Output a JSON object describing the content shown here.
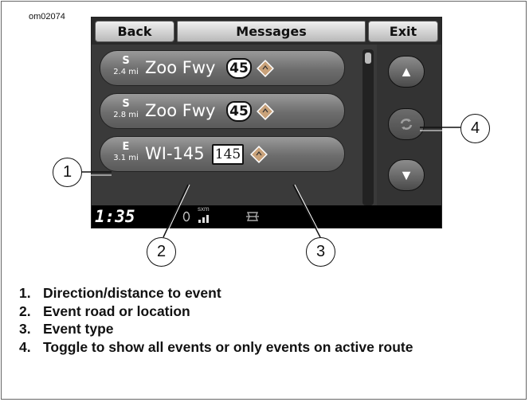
{
  "figure_id": "om02074",
  "screen": {
    "back_label": "Back",
    "title": "Messages",
    "exit_label": "Exit",
    "messages": [
      {
        "direction": "S",
        "distance": "2.4 mi",
        "road": "Zoo Fwy",
        "route_number": "45",
        "route_type": "us-interstate-shield"
      },
      {
        "direction": "S",
        "distance": "2.8 mi",
        "road": "Zoo Fwy",
        "route_number": "45",
        "route_type": "us-interstate-shield"
      },
      {
        "direction": "E",
        "distance": "3.1 mi",
        "road": "WI-145",
        "route_number": "145",
        "route_type": "state-route-shield"
      }
    ],
    "event_icon": "construction-diamond-icon",
    "status": {
      "clock": "1:35",
      "sxm_label": "sxm"
    }
  },
  "callouts": [
    "1",
    "2",
    "3",
    "4"
  ],
  "captions": [
    {
      "num": "1.",
      "text": "Direction/distance to event"
    },
    {
      "num": "2.",
      "text": "Event road or location"
    },
    {
      "num": "3.",
      "text": "Event type"
    },
    {
      "num": "4.",
      "text": "Toggle to show all events or only events on active route"
    }
  ],
  "colors": {
    "screen_bg": "#2a2a2a",
    "diamond": "#c9a27a"
  }
}
